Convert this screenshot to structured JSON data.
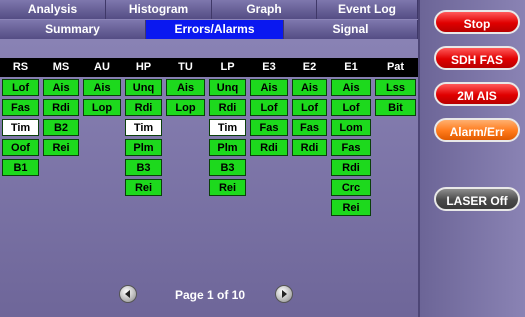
{
  "tabs_top": [
    "Analysis",
    "Histogram",
    "Graph",
    "Event Log"
  ],
  "tabs_second": [
    "Summary",
    "Errors/Alarms",
    "Signal"
  ],
  "columns": [
    "RS",
    "MS",
    "AU",
    "HP",
    "TU",
    "LP",
    "E3",
    "E2",
    "E1",
    "Pat"
  ],
  "grid": {
    "RS": [
      {
        "t": "Lof",
        "c": "green"
      },
      {
        "t": "Fas",
        "c": "green"
      },
      {
        "t": "Tim",
        "c": "white"
      },
      {
        "t": "Oof",
        "c": "green"
      },
      {
        "t": "B1",
        "c": "green"
      }
    ],
    "MS": [
      {
        "t": "Ais",
        "c": "green"
      },
      {
        "t": "Rdi",
        "c": "green"
      },
      {
        "t": "B2",
        "c": "green"
      },
      {
        "t": "Rei",
        "c": "green"
      }
    ],
    "AU": [
      {
        "t": "Ais",
        "c": "green"
      },
      {
        "t": "Lop",
        "c": "green"
      }
    ],
    "HP": [
      {
        "t": "Unq",
        "c": "green"
      },
      {
        "t": "Rdi",
        "c": "green"
      },
      {
        "t": "Tim",
        "c": "white"
      },
      {
        "t": "Plm",
        "c": "green"
      },
      {
        "t": "B3",
        "c": "green"
      },
      {
        "t": "Rei",
        "c": "green"
      }
    ],
    "TU": [
      {
        "t": "Ais",
        "c": "green"
      },
      {
        "t": "Lop",
        "c": "green"
      }
    ],
    "LP": [
      {
        "t": "Unq",
        "c": "green"
      },
      {
        "t": "Rdi",
        "c": "green"
      },
      {
        "t": "Tim",
        "c": "white"
      },
      {
        "t": "Plm",
        "c": "green"
      },
      {
        "t": "B3",
        "c": "green"
      },
      {
        "t": "Rei",
        "c": "green"
      }
    ],
    "E3": [
      {
        "t": "Ais",
        "c": "green"
      },
      {
        "t": "Lof",
        "c": "green"
      },
      {
        "t": "Fas",
        "c": "green"
      },
      {
        "t": "Rdi",
        "c": "green"
      }
    ],
    "E2": [
      {
        "t": "Ais",
        "c": "green"
      },
      {
        "t": "Lof",
        "c": "green"
      },
      {
        "t": "Fas",
        "c": "green"
      },
      {
        "t": "Rdi",
        "c": "green"
      }
    ],
    "E1": [
      {
        "t": "Ais",
        "c": "green"
      },
      {
        "t": "Lof",
        "c": "green"
      },
      {
        "t": "Lom",
        "c": "green"
      },
      {
        "t": "Fas",
        "c": "green"
      },
      {
        "t": "Rdi",
        "c": "green"
      },
      {
        "t": "Crc",
        "c": "green"
      },
      {
        "t": "Rei",
        "c": "green"
      }
    ],
    "Pat": [
      {
        "t": "Lss",
        "c": "green"
      },
      {
        "t": "Bit",
        "c": "green"
      }
    ]
  },
  "colors": {
    "green": "#1dd91d",
    "white": "#ffffff",
    "active_tab": "#0a18f0"
  },
  "pager": {
    "text": "Page 1 of 10",
    "prev_icon": "arrow-left-icon",
    "next_icon": "arrow-right-icon"
  },
  "side_buttons": [
    {
      "label": "Stop",
      "style": "red"
    },
    {
      "label": "SDH FAS",
      "style": "red"
    },
    {
      "label": "2M AIS",
      "style": "red"
    },
    {
      "label": "Alarm/Err",
      "style": "orange"
    },
    {
      "label": "LASER Off",
      "style": "gray"
    }
  ]
}
